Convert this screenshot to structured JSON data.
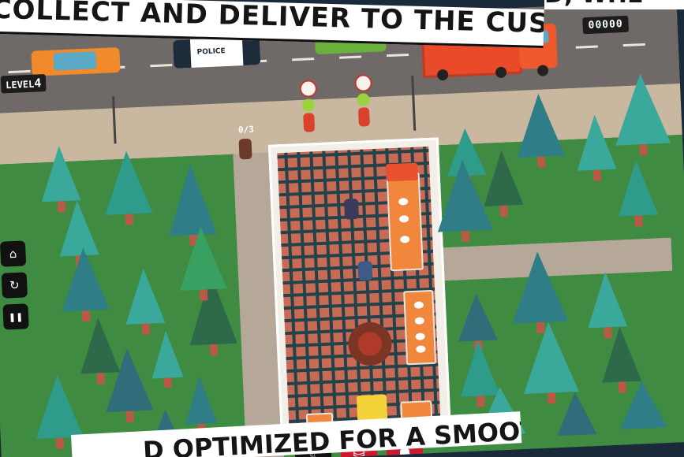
{
  "banner": {
    "top_text": "COLLECT AND DELIVER TO THE CUSTOMERS.",
    "top_right_text": "D, WHE",
    "bottom_text": "D OPTIMIZED FOR A SMOOTH"
  },
  "hud": {
    "level_label": "LEVEL",
    "level_number": "4",
    "score": "00000",
    "customer_counter": "0/3"
  },
  "cars": {
    "police_label": "POLICE"
  },
  "side_controls": [
    {
      "name": "home-button",
      "icon": "home-icon",
      "glyph": "⌂"
    },
    {
      "name": "restart-button",
      "icon": "restart-icon",
      "glyph": "↻"
    },
    {
      "name": "pause-button",
      "icon": "pause-icon",
      "glyph": "❚❚"
    }
  ],
  "bottom_actions": [
    {
      "name": "chef-button",
      "icon": "chef-hat-icon",
      "glyph": "♨",
      "color": "#111111"
    },
    {
      "name": "basket-button",
      "icon": "basket-icon",
      "glyph": "⛁",
      "color": "#d0172b"
    },
    {
      "name": "staff-button",
      "icon": "person-icon",
      "glyph": "☗",
      "color": "#d0172b"
    }
  ],
  "colors": {
    "road": "#6f6a67",
    "grass": "#3f8b41",
    "floor": "#c86a55",
    "counter": "#f0873c",
    "truck": "#e84a2a",
    "tree_light": "#3aa89a",
    "tree_dark": "#2f7d86"
  }
}
